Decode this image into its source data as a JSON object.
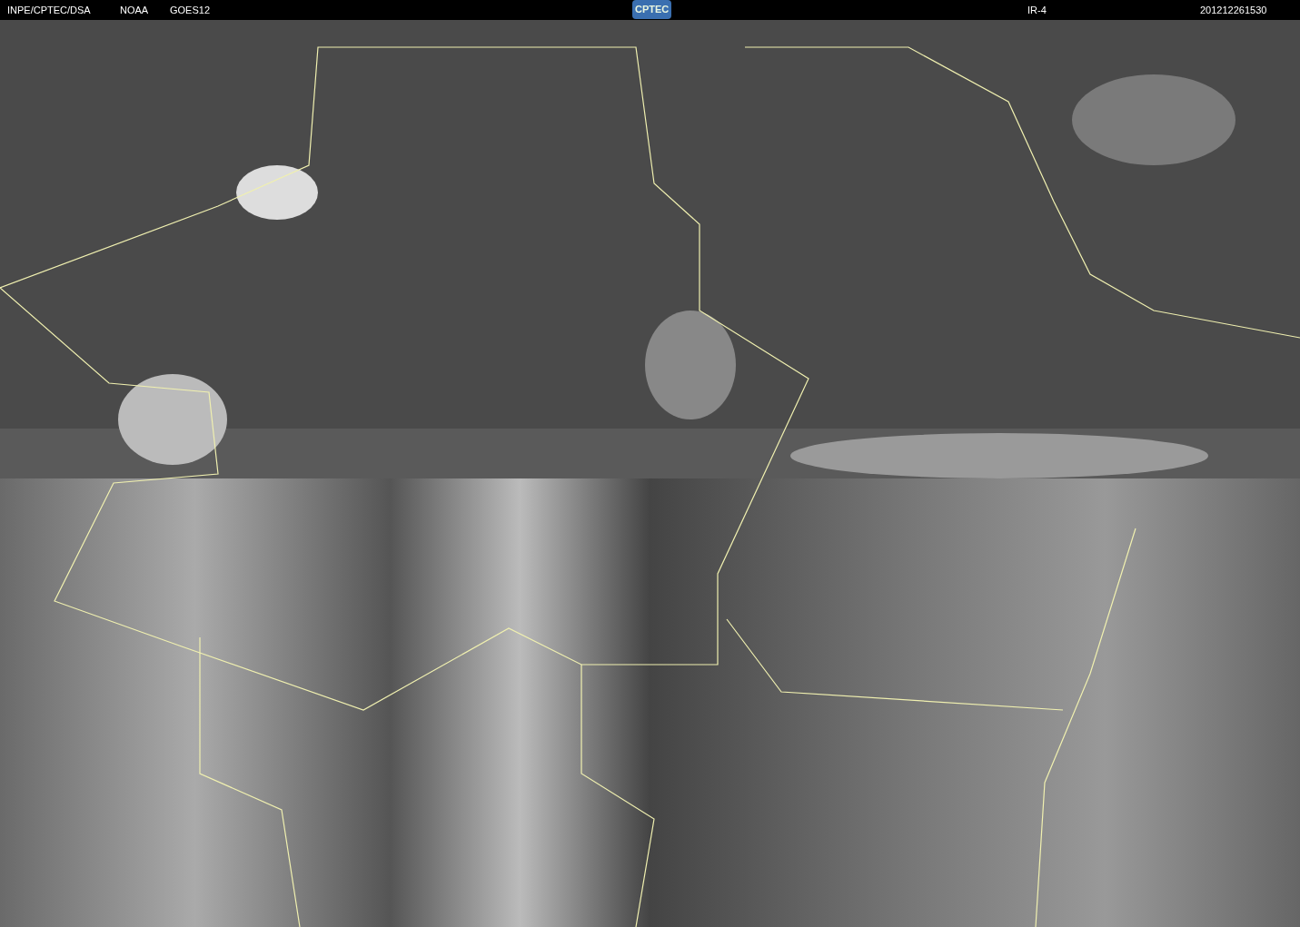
{
  "header": {
    "source": "INPE/CPTEC/DSA",
    "agency": "NOAA",
    "satellite": "GOES12",
    "logo": "CPTEC",
    "channel": "IR-4",
    "timestamp": "201212261530"
  }
}
